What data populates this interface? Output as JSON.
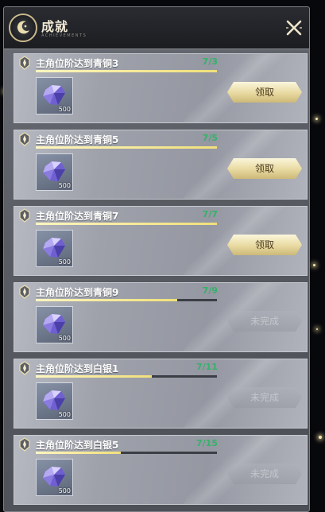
{
  "header": {
    "title": "成就",
    "subtitle": "ACHIEVEMENTS",
    "close_icon": "close-icon"
  },
  "colors": {
    "progress_count": "#36b16a",
    "progress_fill": "#f0e07a",
    "claim_button": "#e8d9a0"
  },
  "achievements": [
    {
      "name": "主角位阶达到青铜3",
      "progress_text": "7/3",
      "progress": 1.0,
      "reward_qty": "500",
      "reward_icon": "crystal-gem-icon",
      "button_label": "领取",
      "claimable": true
    },
    {
      "name": "主角位阶达到青铜5",
      "progress_text": "7/5",
      "progress": 1.0,
      "reward_qty": "500",
      "reward_icon": "crystal-gem-icon",
      "button_label": "领取",
      "claimable": true
    },
    {
      "name": "主角位阶达到青铜7",
      "progress_text": "7/7",
      "progress": 1.0,
      "reward_qty": "500",
      "reward_icon": "crystal-gem-icon",
      "button_label": "领取",
      "claimable": true
    },
    {
      "name": "主角位阶达到青铜9",
      "progress_text": "7/9",
      "progress": 0.78,
      "reward_qty": "500",
      "reward_icon": "crystal-gem-icon",
      "button_label": "未完成",
      "claimable": false
    },
    {
      "name": "主角位阶达到白银1",
      "progress_text": "7/11",
      "progress": 0.64,
      "reward_qty": "500",
      "reward_icon": "crystal-gem-icon",
      "button_label": "未完成",
      "claimable": false
    },
    {
      "name": "主角位阶达到白银5",
      "progress_text": "7/15",
      "progress": 0.47,
      "reward_qty": "500",
      "reward_icon": "crystal-gem-icon",
      "button_label": "未完成",
      "claimable": false
    }
  ]
}
